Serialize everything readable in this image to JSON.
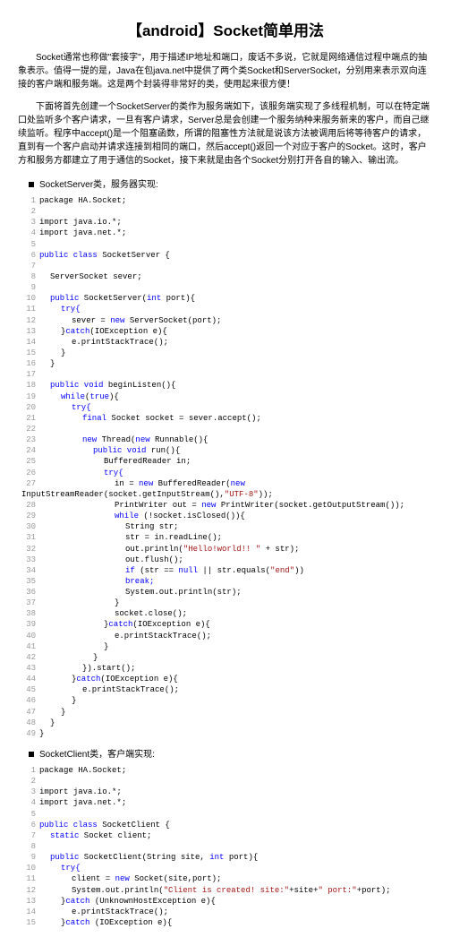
{
  "title": "【android】Socket简单用法",
  "p1": "Socket通常也称做\"套接字\"，用于描述IP地址和端口，废话不多说，它就是网络通信过程中端点的抽象表示。值得一提的是，Java在包java.net中提供了两个类Socket和ServerSocket，分别用来表示双向连接的客户端和服务端。这是两个封装得非常好的类，使用起来很方便！",
  "p2": "下面将首先创建一个SocketServer的类作为服务端如下，该服务端实现了多线程机制，可以在特定端口处监听多个客户请求，一旦有客户请求，Server总是会创建一个服务纳种来服务新来的客户，而自己继续监听。程序中accept()是一个阻塞函数，所谓的阻塞性方法就是说该方法被调用后将等待客户的请求，直到有一个客户启动并请求连接到相同的端口，然后accept()返回一个对应于客户的Socket。这时，客户方和服务方都建立了用于通信的Socket，接下来就是由各个Socket分别打开各自的输入、输出流。",
  "s1": "SocketServer类，服务器实现:",
  "s2": "SocketClient类，客户端实现:",
  "c1": {
    "l1": "package HA.Socket;",
    "l3": "import java.io.*;",
    "l4": "import java.net.*;",
    "l6a": "public class ",
    "l6b": "SocketServer {",
    "l8": "ServerSocket sever;",
    "l10a": "public",
    "l10b": " SocketServer(",
    "l10c": "int",
    "l10d": " port){",
    "l11": "try{",
    "l12a": "sever = ",
    "l12b": "new",
    "l12c": " ServerSocket(port);",
    "l13a": "}",
    "l13b": "catch",
    "l13c": "(IOException e){",
    "l14": "e.printStackTrace();",
    "l15": "}",
    "l16": "}",
    "l18a": "public void",
    "l18b": " beginListen(){",
    "l19a": "while",
    "l19b": "(",
    "l19c": "true",
    "l19d": "){",
    "l20": "try{",
    "l21a": "final",
    "l21b": " Socket socket = sever.accept();",
    "l23a": "new",
    "l23b": " Thread(",
    "l23c": "new",
    "l23d": " Runnable(){",
    "l24a": "public void",
    "l24b": " run(){",
    "l25": "BufferedReader in;",
    "l26": "try{",
    "l27a": "in = ",
    "l27b": "new",
    "l27c": " BufferedReader(",
    "l27d": "new",
    "l27e": " InputStreamReader(socket.getInputStream(),",
    "l27f": "\"UTF-8\"",
    "l27g": "));",
    "l28a": "PrintWriter out = ",
    "l28b": "new",
    "l28c": " PrintWriter(socket.getOutputStream());",
    "l29a": "while",
    "l29b": " (!socket.isClosed()){",
    "l30": "String str;",
    "l31": "str = in.readLine();",
    "l32a": "out.println(",
    "l32b": "\"Hello!world!! \"",
    "l32c": " + str);",
    "l33": "out.flush();",
    "l34a": "if",
    "l34b": " (str == ",
    "l34c": "null",
    "l34d": " || str.equals(",
    "l34e": "\"end\"",
    "l34f": "))",
    "l35": "break;",
    "l36": "System.out.println(str);",
    "l37": "}",
    "l38": "socket.close();",
    "l39a": "}",
    "l39b": "catch",
    "l39c": "(IOException e){",
    "l40": "e.printStackTrace();",
    "l41": "}",
    "l42": "}",
    "l43": "}).start();",
    "l44a": "}",
    "l44b": "catch",
    "l44c": "(IOException e){",
    "l45": "e.printStackTrace();",
    "l46": "}",
    "l47": "}",
    "l48": "}",
    "l49": "}"
  },
  "c2": {
    "l1": "package HA.Socket;",
    "l3": "import java.io.*;",
    "l4": "import java.net.*;",
    "l6a": "public class ",
    "l6b": "SocketClient {",
    "l7a": "static",
    "l7b": " Socket client;",
    "l9a": "public",
    "l9b": " SocketClient(String site, ",
    "l9c": "int",
    "l9d": " port){",
    "l10": "try{",
    "l11a": "client = ",
    "l11b": "new",
    "l11c": " Socket(site,port);",
    "l12a": "System.out.println(",
    "l12b": "\"Client is created! site:\"",
    "l12c": "+site+",
    "l12d": "\" port:\"",
    "l12e": "+port);",
    "l13a": "}",
    "l13b": "catch",
    "l13c": " (UnknownHostException e){",
    "l14": "e.printStackTrace();",
    "l15a": "}",
    "l15b": "catch",
    "l15c": " (IOException e){"
  }
}
